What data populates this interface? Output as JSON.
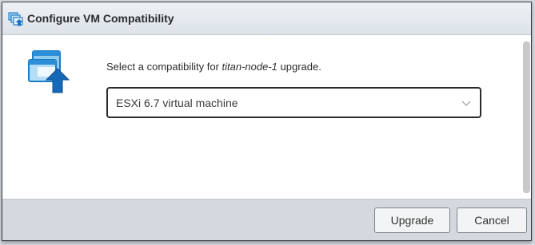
{
  "dialog": {
    "title": "Configure VM Compatibility",
    "title_icon": "vm-compatibility-icon",
    "body_icon": "vm-upgrade-icon"
  },
  "prompt": {
    "prefix": "Select a compatibility for ",
    "vm_name": "titan-node-1",
    "suffix": " upgrade."
  },
  "compatibility_select": {
    "selected": "ESXi 6.7 virtual machine",
    "icon": "chevron-down-icon"
  },
  "buttons": {
    "upgrade": "Upgrade",
    "cancel": "Cancel"
  },
  "colors": {
    "accent_blue": "#1a8ad8",
    "footer_bg": "#d4d9df",
    "select_border": "#2b2b2b"
  }
}
